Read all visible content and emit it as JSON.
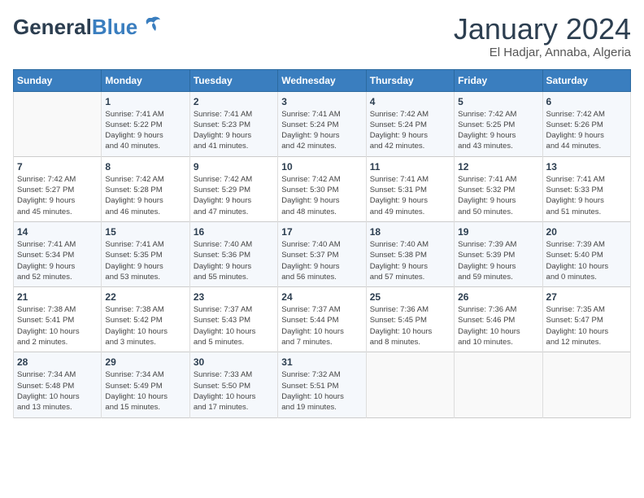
{
  "header": {
    "logo_general": "General",
    "logo_blue": "Blue",
    "month_title": "January 2024",
    "subtitle": "El Hadjar, Annaba, Algeria"
  },
  "days_of_week": [
    "Sunday",
    "Monday",
    "Tuesday",
    "Wednesday",
    "Thursday",
    "Friday",
    "Saturday"
  ],
  "weeks": [
    [
      {
        "day": "",
        "sunrise": "",
        "sunset": "",
        "daylight": ""
      },
      {
        "day": "1",
        "sunrise": "Sunrise: 7:41 AM",
        "sunset": "Sunset: 5:22 PM",
        "daylight": "Daylight: 9 hours and 40 minutes."
      },
      {
        "day": "2",
        "sunrise": "Sunrise: 7:41 AM",
        "sunset": "Sunset: 5:23 PM",
        "daylight": "Daylight: 9 hours and 41 minutes."
      },
      {
        "day": "3",
        "sunrise": "Sunrise: 7:41 AM",
        "sunset": "Sunset: 5:24 PM",
        "daylight": "Daylight: 9 hours and 42 minutes."
      },
      {
        "day": "4",
        "sunrise": "Sunrise: 7:42 AM",
        "sunset": "Sunset: 5:24 PM",
        "daylight": "Daylight: 9 hours and 42 minutes."
      },
      {
        "day": "5",
        "sunrise": "Sunrise: 7:42 AM",
        "sunset": "Sunset: 5:25 PM",
        "daylight": "Daylight: 9 hours and 43 minutes."
      },
      {
        "day": "6",
        "sunrise": "Sunrise: 7:42 AM",
        "sunset": "Sunset: 5:26 PM",
        "daylight": "Daylight: 9 hours and 44 minutes."
      }
    ],
    [
      {
        "day": "7",
        "sunrise": "Sunrise: 7:42 AM",
        "sunset": "Sunset: 5:27 PM",
        "daylight": "Daylight: 9 hours and 45 minutes."
      },
      {
        "day": "8",
        "sunrise": "Sunrise: 7:42 AM",
        "sunset": "Sunset: 5:28 PM",
        "daylight": "Daylight: 9 hours and 46 minutes."
      },
      {
        "day": "9",
        "sunrise": "Sunrise: 7:42 AM",
        "sunset": "Sunset: 5:29 PM",
        "daylight": "Daylight: 9 hours and 47 minutes."
      },
      {
        "day": "10",
        "sunrise": "Sunrise: 7:42 AM",
        "sunset": "Sunset: 5:30 PM",
        "daylight": "Daylight: 9 hours and 48 minutes."
      },
      {
        "day": "11",
        "sunrise": "Sunrise: 7:41 AM",
        "sunset": "Sunset: 5:31 PM",
        "daylight": "Daylight: 9 hours and 49 minutes."
      },
      {
        "day": "12",
        "sunrise": "Sunrise: 7:41 AM",
        "sunset": "Sunset: 5:32 PM",
        "daylight": "Daylight: 9 hours and 50 minutes."
      },
      {
        "day": "13",
        "sunrise": "Sunrise: 7:41 AM",
        "sunset": "Sunset: 5:33 PM",
        "daylight": "Daylight: 9 hours and 51 minutes."
      }
    ],
    [
      {
        "day": "14",
        "sunrise": "Sunrise: 7:41 AM",
        "sunset": "Sunset: 5:34 PM",
        "daylight": "Daylight: 9 hours and 52 minutes."
      },
      {
        "day": "15",
        "sunrise": "Sunrise: 7:41 AM",
        "sunset": "Sunset: 5:35 PM",
        "daylight": "Daylight: 9 hours and 53 minutes."
      },
      {
        "day": "16",
        "sunrise": "Sunrise: 7:40 AM",
        "sunset": "Sunset: 5:36 PM",
        "daylight": "Daylight: 9 hours and 55 minutes."
      },
      {
        "day": "17",
        "sunrise": "Sunrise: 7:40 AM",
        "sunset": "Sunset: 5:37 PM",
        "daylight": "Daylight: 9 hours and 56 minutes."
      },
      {
        "day": "18",
        "sunrise": "Sunrise: 7:40 AM",
        "sunset": "Sunset: 5:38 PM",
        "daylight": "Daylight: 9 hours and 57 minutes."
      },
      {
        "day": "19",
        "sunrise": "Sunrise: 7:39 AM",
        "sunset": "Sunset: 5:39 PM",
        "daylight": "Daylight: 9 hours and 59 minutes."
      },
      {
        "day": "20",
        "sunrise": "Sunrise: 7:39 AM",
        "sunset": "Sunset: 5:40 PM",
        "daylight": "Daylight: 10 hours and 0 minutes."
      }
    ],
    [
      {
        "day": "21",
        "sunrise": "Sunrise: 7:38 AM",
        "sunset": "Sunset: 5:41 PM",
        "daylight": "Daylight: 10 hours and 2 minutes."
      },
      {
        "day": "22",
        "sunrise": "Sunrise: 7:38 AM",
        "sunset": "Sunset: 5:42 PM",
        "daylight": "Daylight: 10 hours and 3 minutes."
      },
      {
        "day": "23",
        "sunrise": "Sunrise: 7:37 AM",
        "sunset": "Sunset: 5:43 PM",
        "daylight": "Daylight: 10 hours and 5 minutes."
      },
      {
        "day": "24",
        "sunrise": "Sunrise: 7:37 AM",
        "sunset": "Sunset: 5:44 PM",
        "daylight": "Daylight: 10 hours and 7 minutes."
      },
      {
        "day": "25",
        "sunrise": "Sunrise: 7:36 AM",
        "sunset": "Sunset: 5:45 PM",
        "daylight": "Daylight: 10 hours and 8 minutes."
      },
      {
        "day": "26",
        "sunrise": "Sunrise: 7:36 AM",
        "sunset": "Sunset: 5:46 PM",
        "daylight": "Daylight: 10 hours and 10 minutes."
      },
      {
        "day": "27",
        "sunrise": "Sunrise: 7:35 AM",
        "sunset": "Sunset: 5:47 PM",
        "daylight": "Daylight: 10 hours and 12 minutes."
      }
    ],
    [
      {
        "day": "28",
        "sunrise": "Sunrise: 7:34 AM",
        "sunset": "Sunset: 5:48 PM",
        "daylight": "Daylight: 10 hours and 13 minutes."
      },
      {
        "day": "29",
        "sunrise": "Sunrise: 7:34 AM",
        "sunset": "Sunset: 5:49 PM",
        "daylight": "Daylight: 10 hours and 15 minutes."
      },
      {
        "day": "30",
        "sunrise": "Sunrise: 7:33 AM",
        "sunset": "Sunset: 5:50 PM",
        "daylight": "Daylight: 10 hours and 17 minutes."
      },
      {
        "day": "31",
        "sunrise": "Sunrise: 7:32 AM",
        "sunset": "Sunset: 5:51 PM",
        "daylight": "Daylight: 10 hours and 19 minutes."
      },
      {
        "day": "",
        "sunrise": "",
        "sunset": "",
        "daylight": ""
      },
      {
        "day": "",
        "sunrise": "",
        "sunset": "",
        "daylight": ""
      },
      {
        "day": "",
        "sunrise": "",
        "sunset": "",
        "daylight": ""
      }
    ]
  ]
}
